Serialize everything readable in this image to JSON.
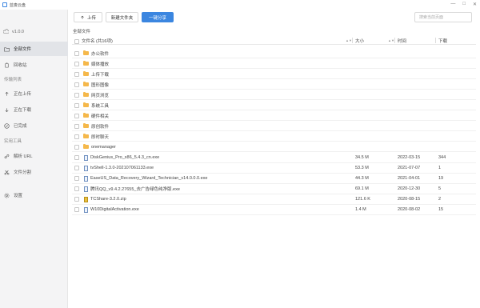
{
  "app": {
    "title": "蓝奏云盘"
  },
  "window_controls": {
    "minimize": "—",
    "maximize": "□",
    "close": "✕"
  },
  "sidebar": {
    "version": "v1.0.0",
    "items_main": [
      {
        "label": "全部文件",
        "icon": "folder-icon",
        "active": true
      },
      {
        "label": "回收站",
        "icon": "recycle-bin-icon",
        "active": false
      }
    ],
    "section_transfer": "传输列表",
    "items_transfer": [
      {
        "label": "正在上传",
        "icon": "upload-icon"
      },
      {
        "label": "正在下载",
        "icon": "download-icon"
      },
      {
        "label": "已完成",
        "icon": "check-icon"
      }
    ],
    "section_tools": "实用工具",
    "items_tools": [
      {
        "label": "解析 URL",
        "icon": "link-icon"
      },
      {
        "label": "文件分割",
        "icon": "scissors-icon"
      }
    ],
    "settings": {
      "label": "设置",
      "icon": "gear-icon"
    }
  },
  "toolbar": {
    "upload_label": "上传",
    "new_folder_label": "新建文件夹",
    "share_label": "一键分享",
    "search_placeholder": "搜索当前页面"
  },
  "breadcrumb": "全部文件",
  "table": {
    "headers": {
      "name": "文件名 (共16项)",
      "size": "大小",
      "time": "时间",
      "downloads": "下载"
    },
    "folders": [
      "办公软件",
      "媒体播放",
      "上传下载",
      "图形图像",
      "网页浏览",
      "系统工具",
      "硬件相关",
      "原创软件",
      "即时聊天",
      "onemanager"
    ],
    "files": [
      {
        "name": "DiskGenius_Pro_x86_5.4.3_cn.exe",
        "size": "34.5 M",
        "time": "2022-03-15",
        "downloads": "344",
        "type": "exe"
      },
      {
        "name": "tvShell-1.3.0-202107061133.exe",
        "size": "53.3 M",
        "time": "2021-07-07",
        "downloads": "1",
        "type": "exe"
      },
      {
        "name": "EaseUS_Data_Recovery_Wizard_Technician_v14.0.0.0.exe",
        "size": "44.3 M",
        "time": "2021-04-01",
        "downloads": "19",
        "type": "exe"
      },
      {
        "name": "腾讯QQ_v9.4.2.27655_去广告绿色纯净版.exe",
        "size": "69.1 M",
        "time": "2020-12-30",
        "downloads": "5",
        "type": "exe"
      },
      {
        "name": "TCShare-3.2.0.zip",
        "size": "121.6 K",
        "time": "2020-08-15",
        "downloads": "2",
        "type": "zip"
      },
      {
        "name": "W10DigitalActivation.exe",
        "size": "1.4 M",
        "time": "2020-08-02",
        "downloads": "15",
        "type": "exe"
      }
    ]
  },
  "colors": {
    "accent": "#3b86e0",
    "folder": "#f5b84b",
    "sidebar_bg": "#f4f4f5",
    "active_bg": "#e2e4e8"
  }
}
